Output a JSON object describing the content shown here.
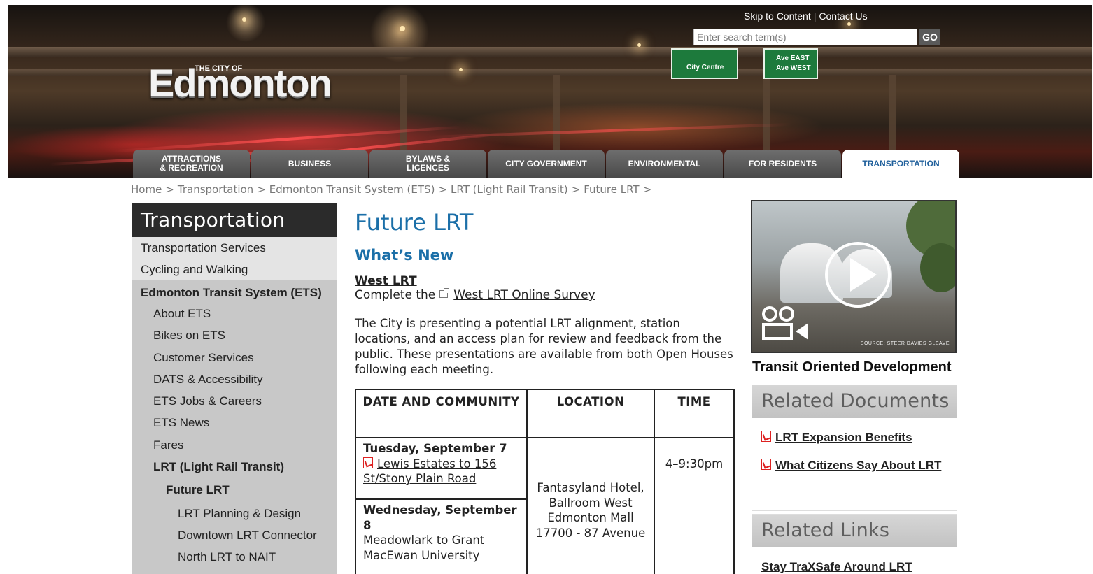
{
  "header": {
    "logo_small": "THE CITY OF",
    "logo_main": "Edmonton",
    "skip_link": "Skip to Content",
    "contact_link": "Contact Us",
    "link_separator": "|",
    "search_placeholder": "Enter search term(s)",
    "search_button": "GO",
    "sign_left": "City Centre",
    "sign_right_1": "Ave EAST",
    "sign_right_2": "Ave WEST"
  },
  "tabs": [
    {
      "label": "ATTRACTIONS\n& RECREATION",
      "active": false
    },
    {
      "label": "BUSINESS",
      "active": false
    },
    {
      "label": "BYLAWS &\nLICENCES",
      "active": false
    },
    {
      "label": "CITY GOVERNMENT",
      "active": false
    },
    {
      "label": "ENVIRONMENTAL",
      "active": false
    },
    {
      "label": "FOR RESIDENTS",
      "active": false
    },
    {
      "label": "TRANSPORTATION",
      "active": true
    }
  ],
  "breadcrumb": {
    "items": [
      "Home",
      "Transportation",
      "Edmonton Transit System (ETS)",
      "LRT (Light Rail Transit)",
      "Future LRT"
    ],
    "separator": ">"
  },
  "leftnav": {
    "title": "Transportation",
    "transportation_services": "Transportation Services",
    "cycling_walking": "Cycling and Walking",
    "ets": "Edmonton Transit System (ETS)",
    "about_ets": "About ETS",
    "bikes_on_ets": "Bikes on ETS",
    "customer_services": "Customer Services",
    "dats": "DATS & Accessibility",
    "ets_jobs": "ETS Jobs & Careers",
    "ets_news": "ETS News",
    "fares": "Fares",
    "lrt": "LRT (Light Rail Transit)",
    "future_lrt": "Future LRT",
    "lrt_planning": "LRT Planning & Design",
    "downtown_lrt": "Downtown LRT Connector",
    "north_lrt": "North LRT to NAIT"
  },
  "main": {
    "title": "Future LRT",
    "subtitle": "What’s New",
    "west_lrt_heading": "West LRT",
    "survey_prefix": "Complete the",
    "survey_link": "West LRT Online Survey",
    "intro": "The City is presenting a potential LRT alignment, station locations, and an access plan for review and feedback from the public. These presentations are available from both Open Houses following each meeting."
  },
  "schedule": {
    "headers": [
      "DATE AND COMMUNITY",
      "LOCATION",
      "TIME"
    ],
    "row1_date": "Tuesday, September 7",
    "row1_community": "Lewis Estates to 156 St/Stony Plain Road",
    "row2_date": "Wednesday, September 8",
    "row2_community": "Meadowlark to Grant MacEwan University",
    "location": "Fantasyland Hotel, Ballroom West Edmonton Mall 17700 - 87 Avenue",
    "time": "4–9:30pm"
  },
  "sidebar": {
    "video_credit": "SOURCE: STEER DAVIES GLEAVE",
    "video_caption": "Transit Oriented Development",
    "related_documents_title": "Related Documents",
    "doc1": "LRT Expansion Benefits",
    "doc2": "What Citizens Say About LRT",
    "related_links_title": "Related Links",
    "link1": "Stay TraXSafe Around LRT"
  },
  "colors": {
    "accent_blue": "#1b6fa8",
    "nav_dark": "#2b2b2b",
    "nav_gray": "#c8c8c8",
    "tab_gray": "#5a5a5a",
    "pdf_red": "#dd2222"
  }
}
